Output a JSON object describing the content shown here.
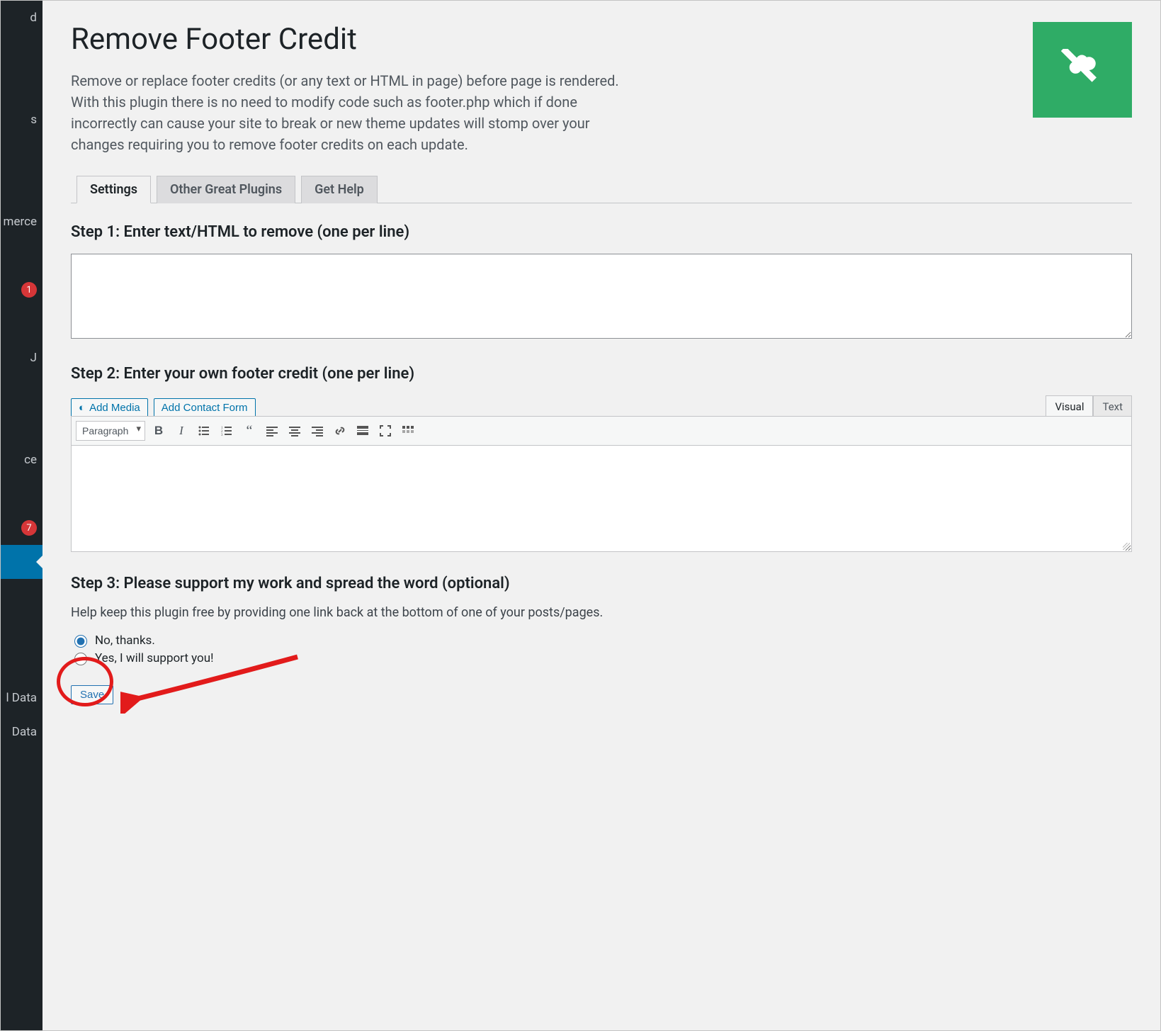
{
  "sidebar": {
    "items": [
      {
        "label": "d",
        "badge": null
      },
      {
        "label": "",
        "badge": null
      },
      {
        "label": "",
        "badge": null
      },
      {
        "label": "s",
        "badge": null
      },
      {
        "label": "",
        "badge": null
      },
      {
        "label": "",
        "badge": null
      },
      {
        "label": "merce",
        "badge": null
      },
      {
        "label": "",
        "badge": null
      },
      {
        "label": "",
        "badge": "1"
      },
      {
        "label": "",
        "badge": null
      },
      {
        "label": "J",
        "badge": null
      },
      {
        "label": "",
        "badge": null
      },
      {
        "label": "",
        "badge": null
      },
      {
        "label": "ce",
        "badge": null
      },
      {
        "label": "",
        "badge": null
      },
      {
        "label": "",
        "badge": "7"
      },
      {
        "label": "",
        "badge": null,
        "active": true
      },
      {
        "label": "",
        "badge": null
      },
      {
        "label": "",
        "badge": null
      },
      {
        "label": "",
        "badge": null
      },
      {
        "label": "l Data",
        "badge": null
      },
      {
        "label": "Data",
        "badge": null
      }
    ]
  },
  "page": {
    "title": "Remove Footer Credit",
    "description": "Remove or replace footer credits (or any text or HTML in page) before page is rendered. With this plugin there is no need to modify code such as footer.php which if done incorrectly can cause your site to break or new theme updates will stomp over your changes requiring you to remove footer credits on each update."
  },
  "tabs": [
    {
      "label": "Settings",
      "active": true
    },
    {
      "label": "Other Great Plugins",
      "active": false
    },
    {
      "label": "Get Help",
      "active": false
    }
  ],
  "step1": {
    "heading": "Step 1: Enter text/HTML to remove (one per line)",
    "value": ""
  },
  "step2": {
    "heading": "Step 2: Enter your own footer credit (one per line)",
    "add_media_label": "Add Media",
    "add_contact_label": "Add Contact Form",
    "editor_tabs": {
      "visual": "Visual",
      "text": "Text"
    },
    "format_select": "Paragraph",
    "content": ""
  },
  "step3": {
    "heading": "Step 3: Please support my work and spread the word (optional)",
    "help": "Help keep this plugin free by providing one link back at the bottom of one of your posts/pages.",
    "option_no": "No, thanks.",
    "option_yes": "Yes, I will support you!",
    "selected": "no"
  },
  "actions": {
    "save_label": "Save"
  }
}
